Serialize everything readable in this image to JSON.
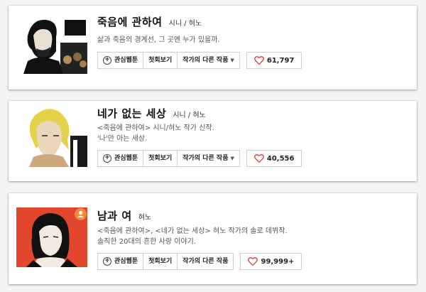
{
  "cards": [
    {
      "title": "죽음에 관하여",
      "authors": "시니 / 혀노",
      "desc": [
        "삶과 죽음의 경계선, 그 곳엔 누가 있을까."
      ],
      "buttons": {
        "interest": "관심웹툰",
        "first": "첫회보기",
        "other": "작가의 다른 작품"
      },
      "likes": "61,797"
    },
    {
      "title": "네가 없는 세상",
      "authors": "시니 / 혀노",
      "desc": [
        "<죽음에 관하여> 시니/혀노 작가 신작.",
        "'나'만 아는 세상."
      ],
      "buttons": {
        "interest": "관심웹툰",
        "first": "첫회보기",
        "other": "작가의 다른 작품"
      },
      "likes": "40,556"
    },
    {
      "title": "남과 여",
      "authors": "혀노",
      "desc": [
        "<죽음에 관하여>, <네가 없는 세상> 혀노 작가의 솔로 데뷔작.",
        "솔직한 20대의 흔한 사랑 이야기."
      ],
      "buttons": {
        "interest": "관심웹툰",
        "first": "첫회보기",
        "other": "작가의 다른 작품"
      },
      "likes": "99,999+"
    }
  ],
  "icons": {
    "like": "heart-icon",
    "interest": "plus-circle-icon",
    "dropdown": "caret-down-icon",
    "badge": "user-badge-icon"
  },
  "colors": {
    "heart": "#e0474c",
    "badge": "#f08a3e",
    "card_border": "#cfcfcf"
  }
}
